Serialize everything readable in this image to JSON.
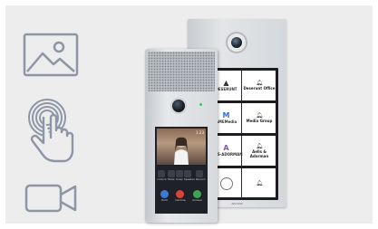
{
  "sidebar": {
    "icons": [
      "image-icon",
      "touch-icon",
      "video-camera-icon"
    ]
  },
  "back_panel": {
    "rows": [
      {
        "logo": "DESERUNT",
        "name": "Deserunt Office"
      },
      {
        "logo": "AMEMedia",
        "name": "Media Group"
      },
      {
        "logo": "AELS·ADORMAN",
        "name": "Aells & Adorman"
      },
      {
        "logo": "",
        "name": ""
      }
    ],
    "footer": "AKUVOX"
  },
  "front_panel": {
    "video_status": "1:23",
    "controls": [
      "Unlock",
      "Mute",
      "Snap",
      "Speaker",
      "Record"
    ],
    "calls": [
      "Decline",
      "Answer",
      "Hold"
    ]
  },
  "colors": {
    "icon_stroke": "#8e96a6",
    "stage_bg": "#ededed",
    "call_green": "#3aa655",
    "call_red": "#d9443a",
    "call_blue": "#3a7bd5"
  }
}
